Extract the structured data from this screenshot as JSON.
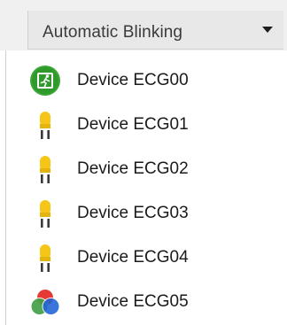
{
  "dropdown": {
    "selected": "Automatic Blinking",
    "icon": "chevron-down-icon"
  },
  "devices": [
    {
      "label": "Device ECG00",
      "icon": "exit-sign-icon",
      "accent": "#3aa635"
    },
    {
      "label": "Device ECG01",
      "icon": "bulb-icon",
      "accent": "#f5c518"
    },
    {
      "label": "Device ECG02",
      "icon": "bulb-icon",
      "accent": "#f5c518"
    },
    {
      "label": "Device ECG03",
      "icon": "bulb-icon",
      "accent": "#f5c518"
    },
    {
      "label": "Device ECG04",
      "icon": "bulb-icon",
      "accent": "#f5c518"
    },
    {
      "label": "Device ECG05",
      "icon": "rgb-light-icon",
      "accent": "#e53935"
    }
  ]
}
